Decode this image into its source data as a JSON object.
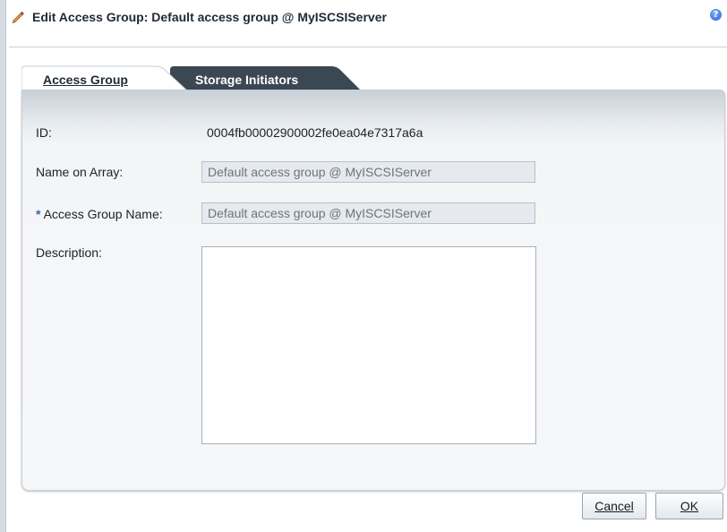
{
  "dialog": {
    "title": "Edit Access Group: Default access group @ MyISCSIServer",
    "help_icon_glyph": "?"
  },
  "tabs": [
    {
      "label": "Access Group",
      "selected": true
    },
    {
      "label": "Storage Initiators",
      "selected": false
    }
  ],
  "form": {
    "id_label": "ID:",
    "id_value": "0004fb00002900002fe0ea04e7317a6a",
    "name_on_array_label": "Name on Array:",
    "name_on_array_value": "Default access group @ MyISCSIServer",
    "required_marker": "*",
    "access_group_name_label": " Access Group Name:",
    "access_group_name_value": "Default access group @ MyISCSIServer",
    "description_label": "Description:",
    "description_value": ""
  },
  "buttons": {
    "cancel": "Cancel",
    "ok": "OK"
  },
  "colors": {
    "selected_tab": "#ffffff",
    "unselected_tab": "#3b4753",
    "required_marker": "#3461b8"
  },
  "icons": [
    "pencil-icon",
    "help-icon"
  ]
}
